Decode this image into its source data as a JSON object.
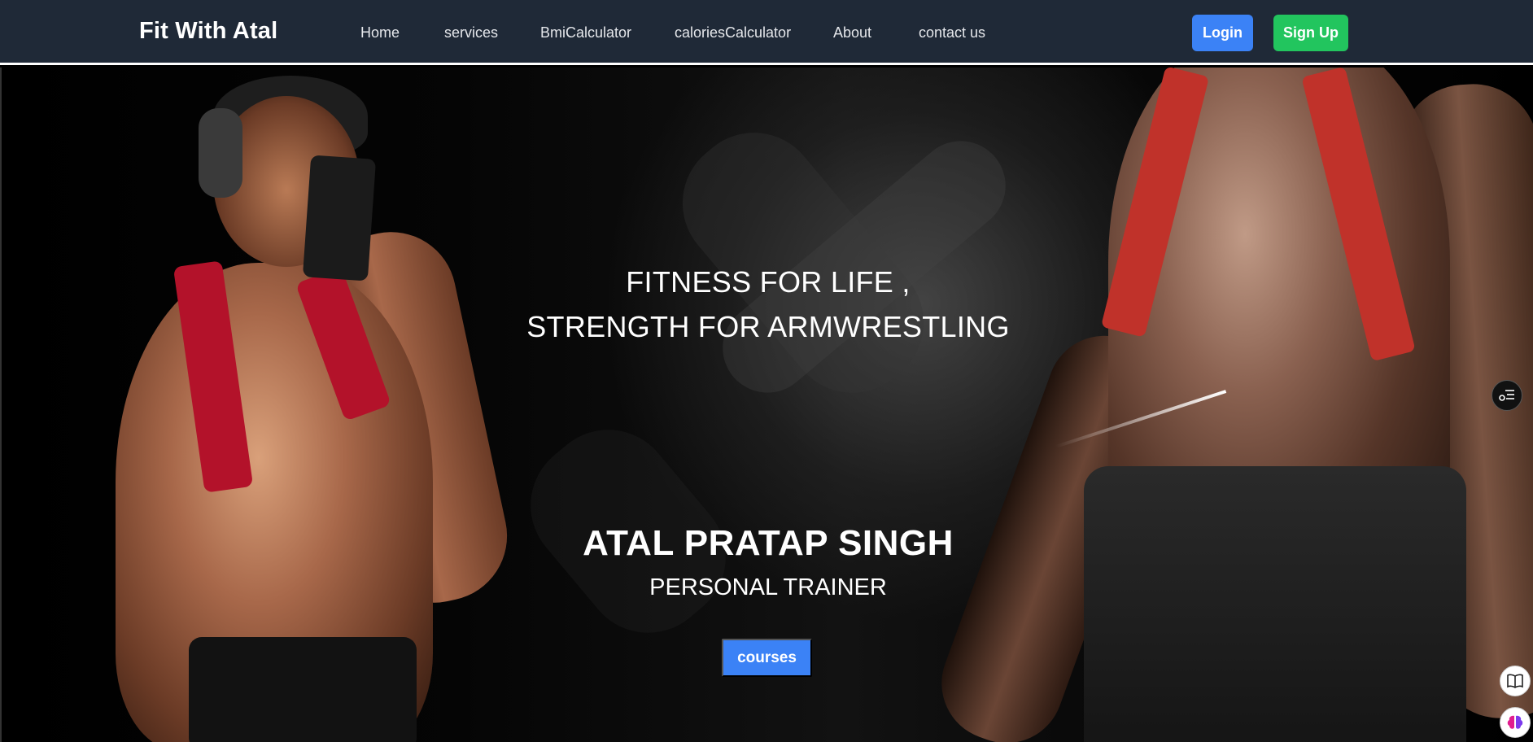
{
  "navbar": {
    "brand": "Fit With Atal",
    "links": [
      {
        "label": "Home"
      },
      {
        "label": "services"
      },
      {
        "label": "BmiCalculator"
      },
      {
        "label": "caloriesCalculator"
      },
      {
        "label": "About"
      },
      {
        "label": "contact us"
      }
    ],
    "login_label": "Login",
    "signup_label": "Sign Up"
  },
  "hero": {
    "tagline_line1": "FITNESS FOR LIFE ,",
    "tagline_line2": "STRENGTH FOR ARMWRESTLING",
    "name": "ATAL PRATAP SINGH",
    "role": "PERSONAL TRAINER",
    "cta_label": "courses"
  },
  "widgets": {
    "menu_icon": "sliders-menu-icon",
    "book_icon": "book-icon",
    "brain_icon": "brain-icon"
  },
  "colors": {
    "nav_bg": "#1f2937",
    "login": "#3b82f6",
    "signup": "#22c55e",
    "cta": "#3b82f6"
  }
}
